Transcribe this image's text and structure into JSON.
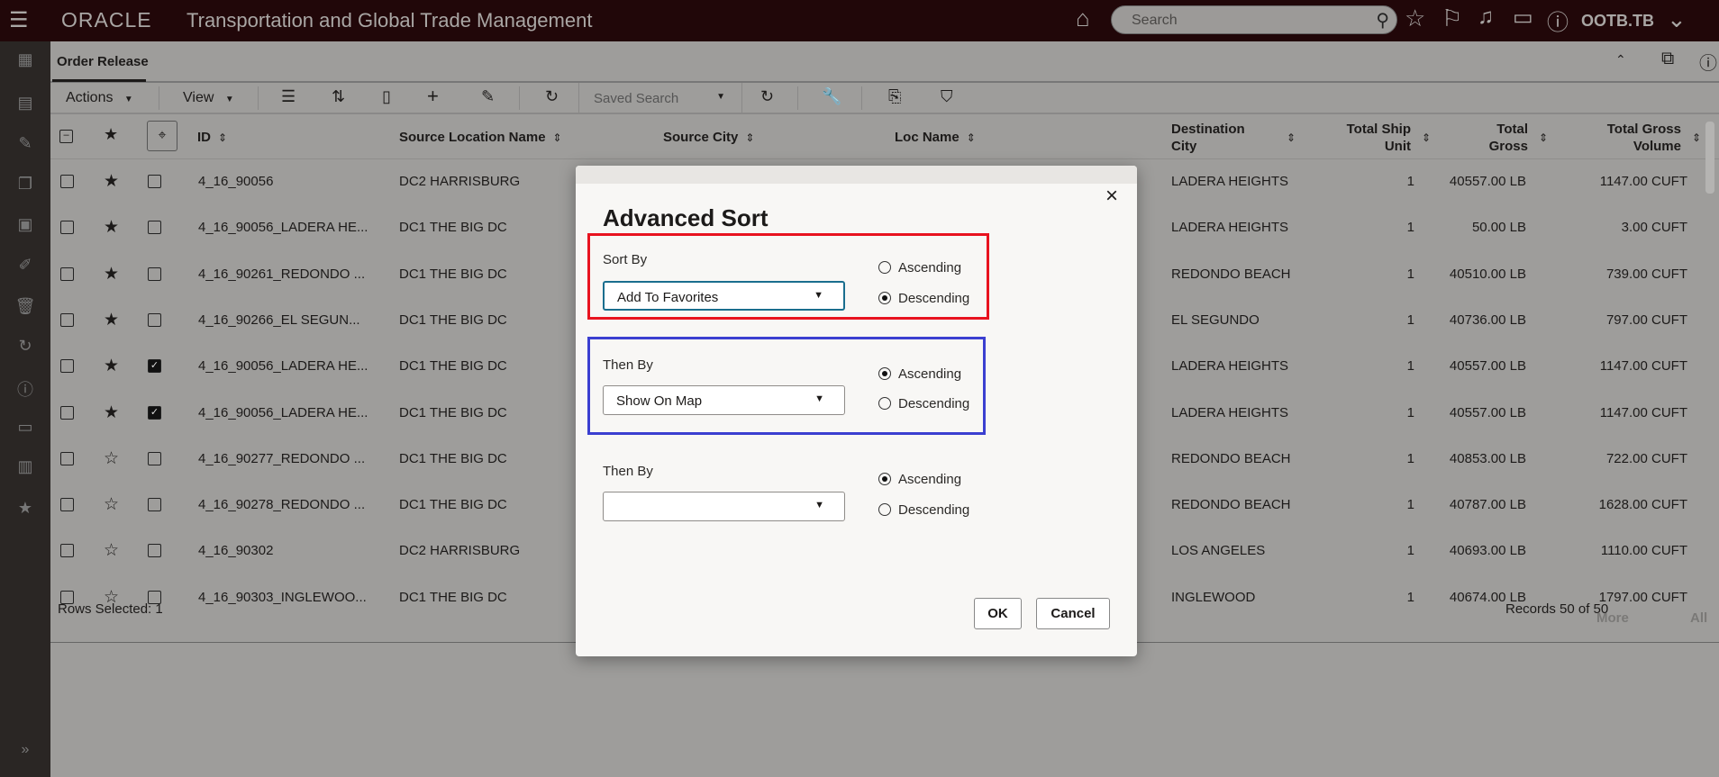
{
  "header": {
    "brand": "ORACLE",
    "app_title": "Transportation and Global Trade Management",
    "search_placeholder": "Search",
    "user": "OOTB.TB"
  },
  "page": {
    "tab": "Order Release"
  },
  "toolbar": {
    "actions": "Actions",
    "view": "View",
    "saved_search": "Saved Search"
  },
  "columns": {
    "id": "ID",
    "source_location": "Source Location Name",
    "source_city": "Source City",
    "loc_name": "Loc Name",
    "dest_city_1": "Destination",
    "dest_city_2": "City",
    "ship_unit_1": "Total Ship",
    "ship_unit_2": "Unit",
    "gross_1": "Total",
    "gross_2": "Gross",
    "volume_1": "Total Gross",
    "volume_2": "Volume"
  },
  "rows": [
    {
      "fav": true,
      "map": false,
      "id": "4_16_90056",
      "src": "DC2 HARRISBURG",
      "dest": "LADERA HEIGHTS",
      "units": "1",
      "gross": "40557.00 LB",
      "vol": "1147.00 CUFT"
    },
    {
      "fav": true,
      "map": false,
      "id": "4_16_90056_LADERA HE...",
      "src": "DC1 THE BIG DC",
      "dest": "LADERA HEIGHTS",
      "units": "1",
      "gross": "50.00 LB",
      "vol": "3.00 CUFT"
    },
    {
      "fav": true,
      "map": false,
      "id": "4_16_90261_REDONDO ...",
      "src": "DC1 THE BIG DC",
      "dest": "REDONDO BEACH",
      "units": "1",
      "gross": "40510.00 LB",
      "vol": "739.00 CUFT"
    },
    {
      "fav": true,
      "map": false,
      "id": "4_16_90266_EL SEGUN...",
      "src": "DC1 THE BIG DC",
      "dest": "EL SEGUNDO",
      "units": "1",
      "gross": "40736.00 LB",
      "vol": "797.00 CUFT"
    },
    {
      "fav": true,
      "map": true,
      "id": "4_16_90056_LADERA HE...",
      "src": "DC1 THE BIG DC",
      "dest": "LADERA HEIGHTS",
      "units": "1",
      "gross": "40557.00 LB",
      "vol": "1147.00 CUFT"
    },
    {
      "fav": true,
      "map": true,
      "id": "4_16_90056_LADERA HE...",
      "src": "DC1 THE BIG DC",
      "dest": "LADERA HEIGHTS",
      "units": "1",
      "gross": "40557.00 LB",
      "vol": "1147.00 CUFT"
    },
    {
      "fav": false,
      "map": false,
      "id": "4_16_90277_REDONDO ...",
      "src": "DC1 THE BIG DC",
      "dest": "REDONDO BEACH",
      "units": "1",
      "gross": "40853.00 LB",
      "vol": "722.00 CUFT"
    },
    {
      "fav": false,
      "map": false,
      "id": "4_16_90278_REDONDO ...",
      "src": "DC1 THE BIG DC",
      "dest": "REDONDO BEACH",
      "units": "1",
      "gross": "40787.00 LB",
      "vol": "1628.00 CUFT"
    },
    {
      "fav": false,
      "map": false,
      "id": "4_16_90302",
      "src": "DC2 HARRISBURG",
      "dest": "LOS ANGELES",
      "units": "1",
      "gross": "40693.00 LB",
      "vol": "1110.00 CUFT"
    },
    {
      "fav": false,
      "map": false,
      "id": "4_16_90303_INGLEWOO...",
      "src": "DC1 THE BIG DC",
      "dest": "INGLEWOOD",
      "units": "1",
      "gross": "40674.00 LB",
      "vol": "1797.00 CUFT"
    }
  ],
  "footer": {
    "rows_selected": "Rows Selected: 1",
    "records": "Records 50 of 50",
    "more": "More",
    "all": "All"
  },
  "dialog": {
    "title": "Advanced Sort",
    "close": "×",
    "levels": [
      {
        "label": "Sort By",
        "value": "Add To Favorites",
        "order": "Descending"
      },
      {
        "label": "Then By",
        "value": "Show On Map",
        "order": "Ascending"
      },
      {
        "label": "Then By",
        "value": "",
        "order": "Ascending"
      }
    ],
    "ascending": "Ascending",
    "descending": "Descending",
    "ok": "OK",
    "cancel": "Cancel",
    "highlight_colors": {
      "red": "#e8131f",
      "blue": "#3b3fd0"
    }
  }
}
